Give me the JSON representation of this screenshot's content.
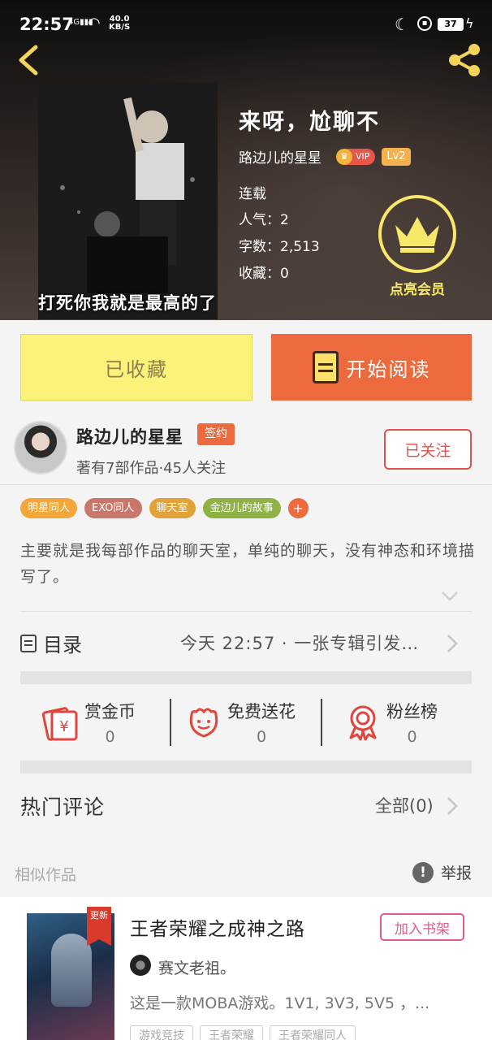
{
  "status_bar": {
    "time": "22:57",
    "network": "4G",
    "speed": "40.0",
    "speed_unit": "KB/S",
    "battery": "37"
  },
  "book": {
    "title": "来呀，尬聊不",
    "author": "路边儿的星星",
    "vip_label": "VIP",
    "level": "Lv2",
    "status": "连载",
    "popularity": "人气：2",
    "word_count": "字数：2,513",
    "favorites": "收藏：0",
    "cover_caption": "打死你我就是最高的了"
  },
  "vip_member": {
    "label": "点亮会员"
  },
  "buttons": {
    "collected": "已收藏",
    "start_reading": "开始阅读"
  },
  "author_card": {
    "name": "路边儿的星星",
    "badge": "签约",
    "stats": "著有7部作品·45人关注",
    "follow": "已关注"
  },
  "tags": [
    {
      "label": "明星同人",
      "color": "#f3a73a"
    },
    {
      "label": "EXO同人",
      "color": "#c9766b"
    },
    {
      "label": "聊天室",
      "color": "#e2a23a"
    },
    {
      "label": "金边儿的故事",
      "color": "#8fb246"
    }
  ],
  "tag_add": "+",
  "description": "主要就是我每部作品的聊天室，单纯的聊天，没有神态和环境描写了。",
  "catalog": {
    "title": "目录",
    "latest": "今天 22:57 · 一张专辑引发…"
  },
  "actions": [
    {
      "label": "赏金币",
      "count": "0"
    },
    {
      "label": "免费送花",
      "count": "0"
    },
    {
      "label": "粉丝榜",
      "count": "0"
    }
  ],
  "comments": {
    "title": "热门评论",
    "all": "全部(0)"
  },
  "similar": {
    "title": "相似作品",
    "report": "举报",
    "card": {
      "ribbon": "更新",
      "title": "王者荣耀之成神之路",
      "add_shelf": "加入书架",
      "author": "赛文老祖。",
      "desc": "这是一款MOBA游戏。1V1, 3V3, 5V5 ，...",
      "tags": [
        "游戏竞技",
        "王者荣耀",
        "王者荣耀同人"
      ]
    }
  },
  "colors": {
    "accent_orange": "#ec6a3d",
    "collected_yellow": "#fbf27a",
    "vip_gold": "#f7e86a",
    "follow_red": "#e25149",
    "shelf_pink": "#e45b8a"
  }
}
